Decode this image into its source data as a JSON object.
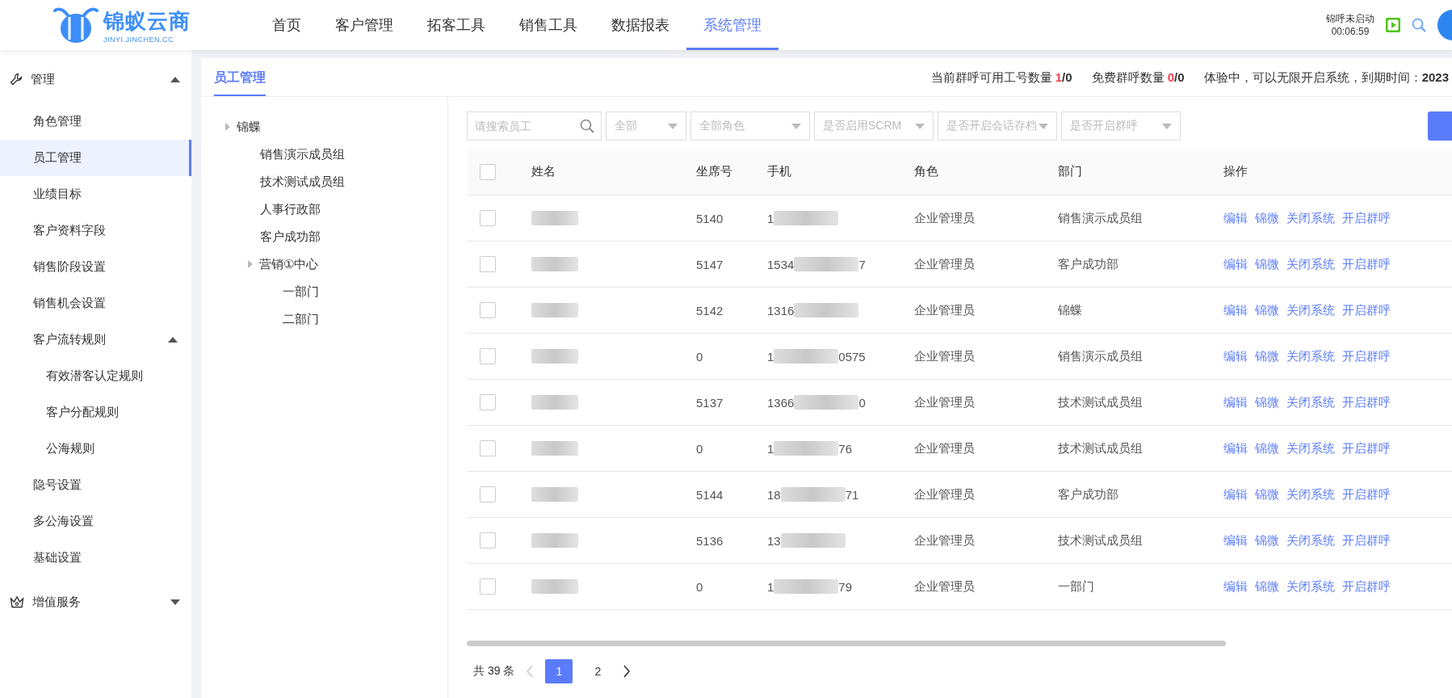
{
  "logo": {
    "name": "锦蚁云商",
    "domain": "JINYI.JINCHEN.CC"
  },
  "nav": [
    {
      "label": "首页",
      "selected": false
    },
    {
      "label": "客户管理",
      "selected": false
    },
    {
      "label": "拓客工具",
      "selected": false
    },
    {
      "label": "销售工具",
      "selected": false
    },
    {
      "label": "数据报表",
      "selected": false
    },
    {
      "label": "系统管理",
      "selected": true
    }
  ],
  "call_status": {
    "label": "锦呼未启动",
    "time": "00:06:59"
  },
  "sidebar": [
    {
      "label": "管理",
      "expanded": true,
      "children": [
        {
          "label": "角色管理",
          "selected": false
        },
        {
          "label": "员工管理",
          "selected": true
        },
        {
          "label": "业绩目标",
          "selected": false
        },
        {
          "label": "客户资料字段",
          "selected": false
        },
        {
          "label": "销售阶段设置",
          "selected": false
        },
        {
          "label": "销售机会设置",
          "selected": false
        },
        {
          "label": "客户流转规则",
          "selected": false,
          "expanded": true,
          "children": [
            {
              "label": "有效潜客认定规则",
              "selected": false
            },
            {
              "label": "客户分配规则",
              "selected": false
            },
            {
              "label": "公海规则",
              "selected": false
            }
          ]
        },
        {
          "label": "隐号设置",
          "selected": false
        },
        {
          "label": "多公海设置",
          "selected": false
        },
        {
          "label": "基础设置",
          "selected": false
        }
      ]
    },
    {
      "label": "增值服务",
      "expanded": false
    }
  ],
  "page_tab": {
    "label": "员工管理",
    "selected": true
  },
  "stats": [
    {
      "label": "当前群呼可用工号数量",
      "used": "1",
      "total": "/0"
    },
    {
      "label": "免费群呼数量",
      "used": "0",
      "total": "/0"
    }
  ],
  "trial": {
    "text": "体验中，可以无限开启系统，到期时间：",
    "date": "2023"
  },
  "tree": [
    {
      "label": "锦蝶",
      "children": [
        {
          "label": "销售演示成员组"
        },
        {
          "label": "技术测试成员组"
        },
        {
          "label": "人事行政部"
        },
        {
          "label": "客户成功部"
        },
        {
          "label": "营销①中心",
          "children": [
            {
              "label": "一部门"
            },
            {
              "label": "二部门"
            }
          ]
        }
      ]
    }
  ],
  "filters": {
    "search_placeholder": "请搜索员工",
    "selects": [
      "全部",
      "全部角色",
      "是否启用SCRM",
      "是否开启会话存档",
      "是否开启群呼"
    ]
  },
  "table": {
    "header_checked": false,
    "columns": [
      "姓名",
      "坐席号",
      "手机",
      "角色",
      "部门",
      "操作"
    ],
    "rows": [
      {
        "checked": false,
        "seat": "5140",
        "phone_start": "1",
        "role": "企业管理员",
        "dept": "销售演示成员组"
      },
      {
        "checked": false,
        "seat": "5147",
        "phone_start": "1534",
        "phone_end": "7",
        "role": "企业管理员",
        "dept": "客户成功部"
      },
      {
        "checked": false,
        "seat": "5142",
        "phone_start": "1316",
        "role": "企业管理员",
        "dept": "锦蝶"
      },
      {
        "checked": false,
        "seat": "0",
        "phone_start": "1",
        "phone_end": "0575",
        "role": "企业管理员",
        "dept": "销售演示成员组"
      },
      {
        "checked": false,
        "seat": "5137",
        "phone_start": "1366",
        "phone_end": "0",
        "role": "企业管理员",
        "dept": "技术测试成员组"
      },
      {
        "checked": false,
        "seat": "0",
        "phone_start": "1",
        "phone_end": "76",
        "role": "企业管理员",
        "dept": "技术测试成员组"
      },
      {
        "checked": false,
        "seat": "5144",
        "phone_start": "18",
        "phone_end": "71",
        "role": "企业管理员",
        "dept": "客户成功部"
      },
      {
        "checked": false,
        "seat": "5136",
        "phone_start": "13",
        "role": "企业管理员",
        "dept": "技术测试成员组"
      },
      {
        "checked": false,
        "seat": "0",
        "phone_start": "1",
        "phone_end": "79",
        "role": "企业管理员",
        "dept": "一部门"
      }
    ],
    "row_actions": [
      [
        "编辑",
        "锦微",
        "关闭系统",
        "开启群呼"
      ],
      [
        "编辑",
        "锦微",
        "关闭系统",
        "开启群呼"
      ],
      [
        "编辑",
        "锦微",
        "关闭系统",
        "开启群呼"
      ],
      [
        "编辑",
        "锦微",
        "关闭系统",
        "开启群呼"
      ],
      [
        "编辑",
        "锦微",
        "关闭系统",
        "开启群呼"
      ],
      [
        "编辑",
        "锦微",
        "关闭系统",
        "开启群呼"
      ],
      [
        "编辑",
        "锦微",
        "关闭系统",
        "开启群呼"
      ],
      [
        "编辑",
        "锦微",
        "关闭系统",
        "开启群呼"
      ],
      [
        "编辑",
        "锦微",
        "关闭系统",
        "开启群呼"
      ]
    ]
  },
  "pagination": {
    "total": "共 39 条",
    "pages": [
      {
        "label": "1",
        "selected": true
      },
      {
        "label": "2",
        "selected": false
      }
    ]
  }
}
